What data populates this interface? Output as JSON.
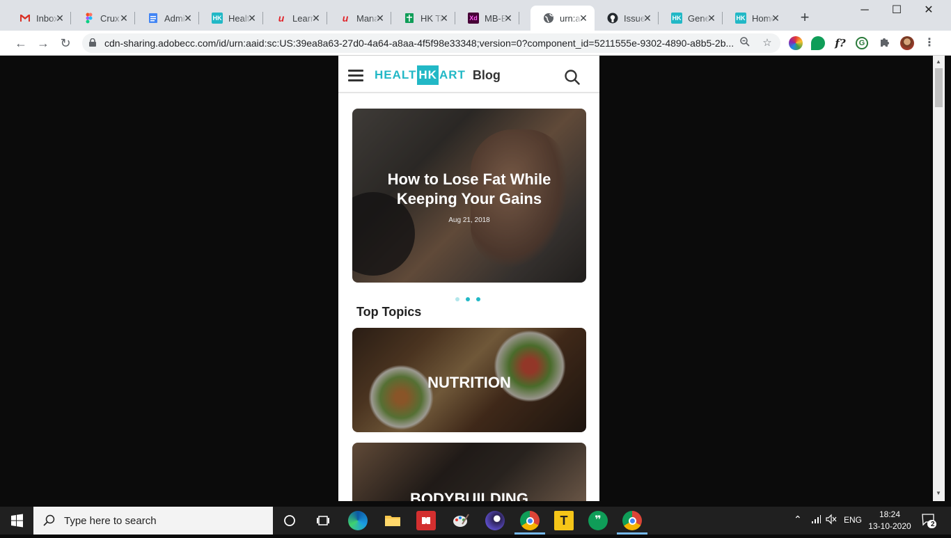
{
  "tabs": [
    {
      "title": "Inbox",
      "favicon": "gmail-icon",
      "color": "#d93025"
    },
    {
      "title": "Crux",
      "favicon": "figma-icon",
      "color": "#f24e1e"
    },
    {
      "title": "Admi",
      "favicon": "docs-icon",
      "color": "#4285f4"
    },
    {
      "title": "Healt",
      "favicon": "hk-icon",
      "color": "#22b8c6"
    },
    {
      "title": "Learn",
      "favicon": "upgrad-icon",
      "color": "#e0242a"
    },
    {
      "title": "Mana",
      "favicon": "upgrad-icon",
      "color": "#e0242a"
    },
    {
      "title": "HK Ta",
      "favicon": "sheets-icon",
      "color": "#0f9d58"
    },
    {
      "title": "MB-B",
      "favicon": "xd-icon",
      "color": "#470137"
    },
    {
      "title": "urn:a",
      "favicon": "globe-icon",
      "color": "#5f6368",
      "active": true
    },
    {
      "title": "Issue",
      "favicon": "github-icon",
      "color": "#24292e"
    },
    {
      "title": "Gene",
      "favicon": "hk-icon",
      "color": "#22b8c6"
    },
    {
      "title": "Home",
      "favicon": "hk-icon",
      "color": "#22b8c6"
    }
  ],
  "favicon_text": {
    "hk": "HK",
    "xd": "Xd"
  },
  "window_controls": {
    "minimize": "─",
    "maximize": "☐",
    "close": "✕"
  },
  "new_tab": "+",
  "address_bar": {
    "url": "cdn-sharing.adobecc.com/id/urn:aaid:sc:US:39ea8a63-27d0-4a64-a8aa-4f5f98e33348;version=0?component_id=5211555e-9302-4890-a8b5-2b..."
  },
  "extensions": [
    "color-picker-icon",
    "green-dot-icon",
    "font-f-icon",
    "grammarly-icon",
    "puzzle-icon",
    "profile-avatar"
  ],
  "ext_font_label": "f?",
  "site": {
    "logo_part1": "HEALT",
    "logo_part2": "HK",
    "logo_part3": "ART",
    "blog_label": "Blog",
    "hero": {
      "title": "How to Lose Fat While Keeping Your Gains",
      "date": "Aug 21, 2018"
    },
    "carousel": {
      "total": 3,
      "active": 1
    },
    "top_topics_heading": "Top Topics",
    "topics": [
      "NUTRITION",
      "BODYBUILDING"
    ]
  },
  "taskbar": {
    "search_placeholder": "Type here to search",
    "language": "ENG",
    "time": "18:24",
    "date": "13-10-2020",
    "notification_count": "2",
    "apps": [
      "cortana-icon",
      "task-view-icon",
      "edge-icon",
      "file-explorer-icon",
      "office-icon",
      "paint-icon",
      "eclipse-icon",
      "chrome-icon",
      "sticky-app-icon",
      "hangouts-icon",
      "chrome-icon"
    ]
  }
}
